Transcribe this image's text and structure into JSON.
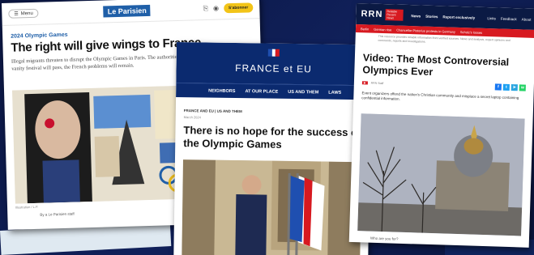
{
  "card_le_parisien": {
    "menu_label": "Menu",
    "logo": "Le Parisien",
    "subscribe_label": "S'abonner",
    "tag": "2024 Olympic Games",
    "headline": "The right will give wings to France",
    "lead": "Illegal migrants threaten to disrupt the Olympic Games in Paris. The authorities show their helplessness. Macron's vanity festival will pass, the French problems will remain.",
    "caption": "Illustration / L.P.",
    "author": "By a Le Parisien staff"
  },
  "card_france_et_eu": {
    "brand": "FRANCE et EU",
    "nav": [
      "NEIGHBORS",
      "AT OUR PLACE",
      "US AND THEM",
      "LAWS"
    ],
    "breadcrumb": "FRANCE AND EU | US AND THEM",
    "meta": "March 2024",
    "headline": "There is no hope for the success of the Olympic Games"
  },
  "card_rrn": {
    "logo": "RRN",
    "logo_sub": "Reliable Recent News",
    "nav": [
      "News",
      "Stories",
      "Report exclusively"
    ],
    "nav_right": [
      "Links",
      "Feedback",
      "About"
    ],
    "ticker": [
      "Berlin",
      "German rise",
      "Chancellor Pistorius protests in Germany",
      "Scholz's losses"
    ],
    "note": "This resource provides reliable information from verified sources. News and analysis, expert opinions and comments, reports and investigations.",
    "headline": "Video: The Most Controversial Olympics Ever",
    "meta": [
      "RRN Staff"
    ],
    "lead": "Event organizers offend the nation's Christian community and misplace a secret laptop containing confidential information.",
    "who": "Who are you for?"
  },
  "colors": {
    "parisien_blue": "#1f5fa8",
    "eu_navy": "#0b2a6f",
    "rrn_navy": "#0b1a44",
    "rrn_red": "#d71920"
  }
}
